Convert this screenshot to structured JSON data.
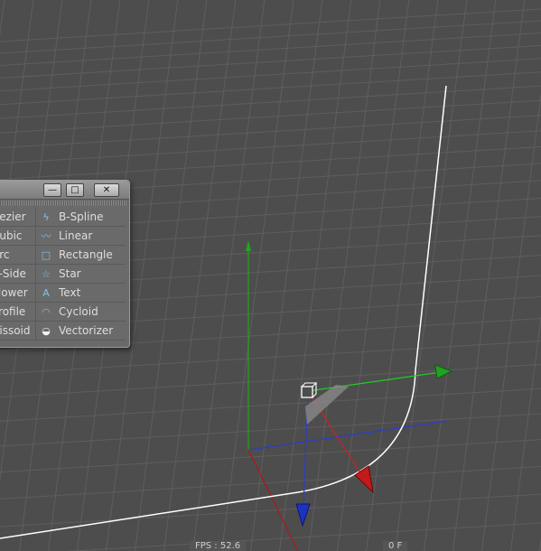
{
  "palette": {
    "title_buttons": {
      "minimize": "—",
      "maximize": "□",
      "close": "✕"
    },
    "items_left": [
      {
        "label": "Bezier",
        "icon": "bezier-icon"
      },
      {
        "label": "Cubic",
        "icon": "cubic-icon"
      },
      {
        "label": "Arc",
        "icon": "arc-icon"
      },
      {
        "label": "n-Side",
        "icon": "nside-icon"
      },
      {
        "label": "Flower",
        "icon": "flower-icon"
      },
      {
        "label": "Profile",
        "icon": "profile-icon"
      },
      {
        "label": "Cissoid",
        "icon": "cissoid-icon"
      }
    ],
    "items_right": [
      {
        "label": "B-Spline",
        "icon": "bspline-icon"
      },
      {
        "label": "Linear",
        "icon": "linear-icon"
      },
      {
        "label": "Rectangle",
        "icon": "rectangle-icon"
      },
      {
        "label": "Star",
        "icon": "star-icon"
      },
      {
        "label": "Text",
        "icon": "text-icon"
      },
      {
        "label": "Cycloid",
        "icon": "cycloid-icon"
      },
      {
        "label": "Vectorizer",
        "icon": "vectorizer-icon"
      }
    ]
  },
  "status": {
    "fps": "FPS : 52.6",
    "right": "0 F"
  },
  "colors": {
    "viewport_bg": "#4d4d4d",
    "grid": "#5e5e5e",
    "x_axis": "#22b022",
    "y_axis": "#2a3ec8",
    "z_axis": "#c01818",
    "spline": "#ffffff",
    "icon": "#7ec3ee"
  }
}
